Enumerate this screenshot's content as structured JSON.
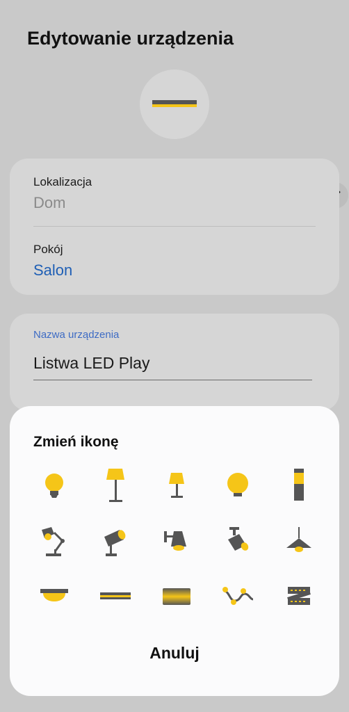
{
  "page": {
    "title": "Edytowanie urządzenia"
  },
  "location": {
    "label": "Lokalizacja",
    "value": "Dom"
  },
  "room": {
    "label": "Pokój",
    "value": "Salon"
  },
  "device_name": {
    "label": "Nazwa urządzenia",
    "value": "Listwa LED Play"
  },
  "icon_sheet": {
    "title": "Zmień ikonę",
    "icons": [
      "bulb-icon",
      "floor-lamp-icon",
      "table-lamp-icon",
      "globe-lamp-icon",
      "pillar-light-icon",
      "desk-lamp-icon",
      "spotlight-icon",
      "wall-lamp-icon",
      "ceiling-spot-icon",
      "pendant-lamp-icon",
      "ceiling-dome-icon",
      "led-bar-icon",
      "light-panel-icon",
      "string-lights-icon",
      "led-strip-icon"
    ],
    "cancel_label": "Anuluj"
  },
  "colors": {
    "accent_yellow": "#ffd53a",
    "icon_gray": "#555555",
    "link_blue": "#1f5fb5"
  }
}
